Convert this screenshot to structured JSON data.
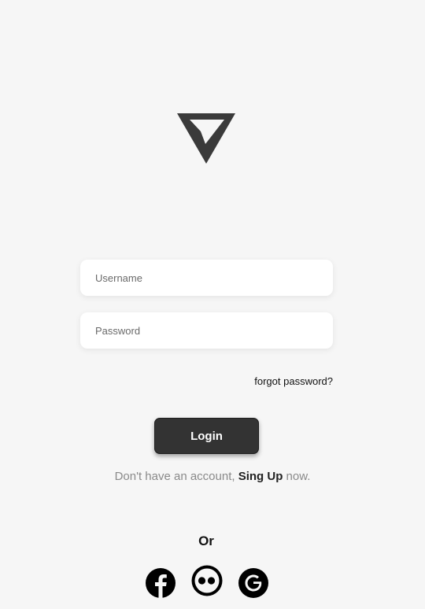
{
  "logo": {
    "icon": "triangle-check-logo"
  },
  "form": {
    "username_placeholder": "Username",
    "password_placeholder": "Password",
    "forgot_label": "forgot password?",
    "login_label": "Login"
  },
  "signup": {
    "prefix": "Don't have an account, ",
    "link": "Sing Up",
    "suffix": " now."
  },
  "social": {
    "or_label": "Or",
    "providers": [
      "facebook",
      "flickr",
      "google"
    ]
  },
  "colors": {
    "background": "#f6f6f6",
    "button": "#333333",
    "muted_text": "#8a8a8a"
  }
}
